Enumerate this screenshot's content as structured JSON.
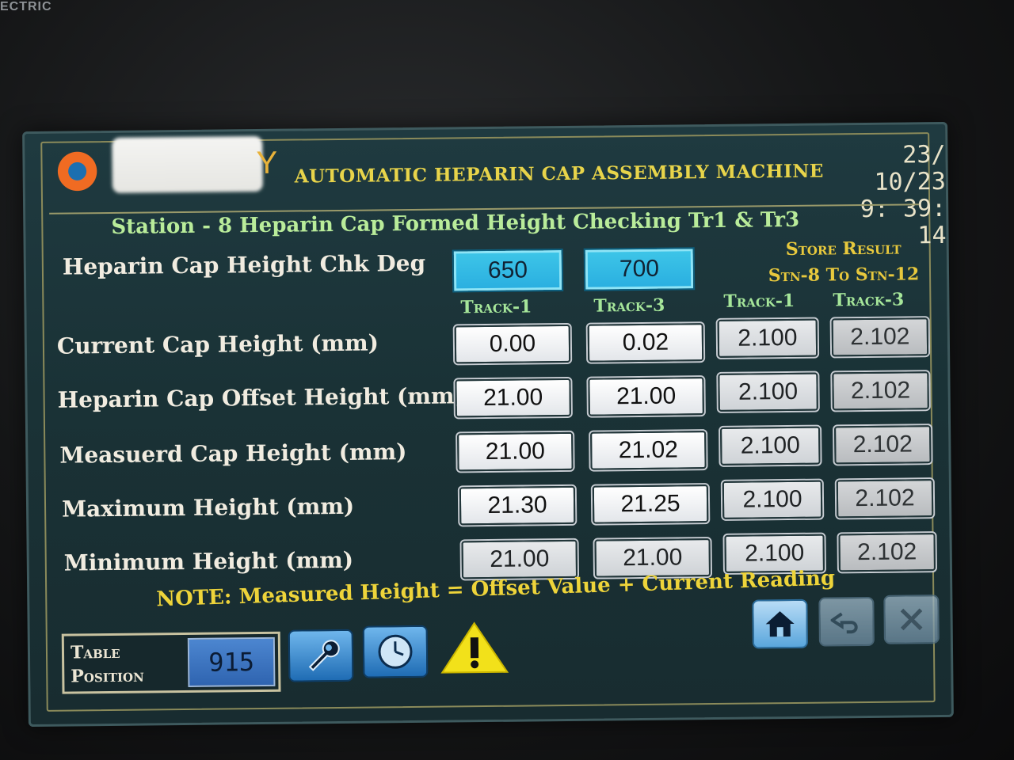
{
  "bezel": {
    "brand_fragment": "ECTRIC"
  },
  "header": {
    "logo_fragment": "Y",
    "machine_title": "AUTOMATIC HEPARIN CAP ASSEMBLY MACHINE",
    "date": "23/ 10/23",
    "time": "9: 39: 14"
  },
  "station_title": "Station - 8 Heparin Cap Formed Height Checking Tr1 & Tr3",
  "check_deg": {
    "label": "Heparin Cap Height Chk Deg",
    "track1": "650",
    "track3": "700"
  },
  "store_result": {
    "line1": "Store Result",
    "line2": "Stn-8 To Stn-12"
  },
  "columns": [
    "Track-1",
    "Track-3",
    "Track-1",
    "Track-3"
  ],
  "rows": [
    {
      "label": "Current Cap Height (mm)",
      "values": [
        "0.00",
        "0.02",
        "2.100",
        "2.102"
      ]
    },
    {
      "label": "Heparin Cap Offset Height (mm)",
      "values": [
        "21.00",
        "21.00",
        "2.100",
        "2.102"
      ]
    },
    {
      "label": "Measuerd Cap Height (mm)",
      "values": [
        "21.00",
        "21.02",
        "2.100",
        "2.102"
      ]
    },
    {
      "label": "Maximum Height (mm)",
      "values": [
        "21.30",
        "21.25",
        "2.100",
        "2.102"
      ]
    },
    {
      "label": "Minimum Height (mm)",
      "values": [
        "21.00",
        "21.00",
        "2.100",
        "2.102"
      ]
    }
  ],
  "note": "NOTE: Measured Height = Offset Value + Current Reading",
  "table_position": {
    "label_line1": "Table",
    "label_line2": "Position",
    "value": "915"
  },
  "toolbar": {
    "icons": [
      "wrench-icon",
      "clock-icon",
      "warning-icon"
    ],
    "nav": [
      "home-icon",
      "back-icon",
      "close-icon"
    ]
  },
  "colors": {
    "title": "#e8d44a",
    "station": "#b9ec9a",
    "track_header": "#a6e69a",
    "deg_box": "#3ec6e8",
    "screen_bg": "#1f3a40"
  }
}
